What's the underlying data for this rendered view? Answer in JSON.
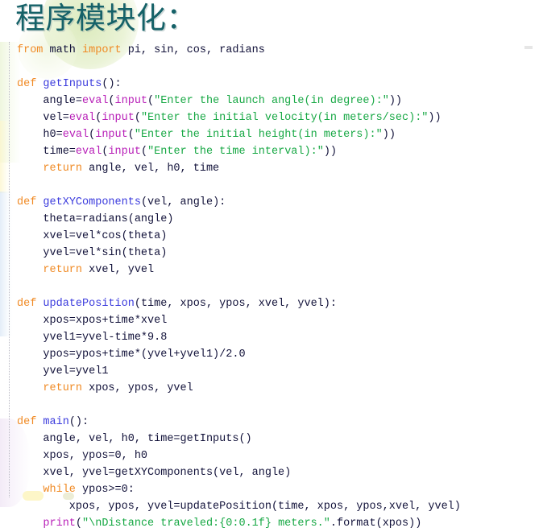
{
  "slide": {
    "title": "程序模块化：",
    "title_color": "#156168"
  },
  "theme": {
    "background": "#ffffff",
    "keyword_color": "#f08a24",
    "function_def_color": "#3b3bdd",
    "builtin_color": "#b820b8",
    "string_color": "#17a844",
    "plain_color": "#12123a",
    "gutter_border_color": "#b9b9c4"
  },
  "code": {
    "language": "python",
    "lines": [
      {
        "n": 1,
        "text": "from math import pi, sin, cos, radians"
      },
      {
        "n": 2,
        "text": ""
      },
      {
        "n": 3,
        "text": "def getInputs():"
      },
      {
        "n": 4,
        "text": "    angle=eval(input(\"Enter the launch angle(in degree):\"))"
      },
      {
        "n": 5,
        "text": "    vel=eval(input(\"Enter the initial velocity(in meters/sec):\"))"
      },
      {
        "n": 6,
        "text": "    h0=eval(input(\"Enter the initial height(in meters):\"))"
      },
      {
        "n": 7,
        "text": "    time=eval(input(\"Enter the time interval):\"))"
      },
      {
        "n": 8,
        "text": "    return angle, vel, h0, time"
      },
      {
        "n": 9,
        "text": ""
      },
      {
        "n": 10,
        "text": "def getXYComponents(vel, angle):"
      },
      {
        "n": 11,
        "text": "    theta=radians(angle)"
      },
      {
        "n": 12,
        "text": "    xvel=vel*cos(theta)"
      },
      {
        "n": 13,
        "text": "    yvel=vel*sin(theta)"
      },
      {
        "n": 14,
        "text": "    return xvel, yvel"
      },
      {
        "n": 15,
        "text": ""
      },
      {
        "n": 16,
        "text": "def updatePosition(time, xpos, ypos, xvel, yvel):"
      },
      {
        "n": 17,
        "text": "    xpos=xpos+time*xvel"
      },
      {
        "n": 18,
        "text": "    yvel1=yvel-time*9.8"
      },
      {
        "n": 19,
        "text": "    ypos=ypos+time*(yvel+yvel1)/2.0"
      },
      {
        "n": 20,
        "text": "    yvel=yvel1"
      },
      {
        "n": 21,
        "text": "    return xpos, ypos, yvel"
      },
      {
        "n": 22,
        "text": ""
      },
      {
        "n": 23,
        "text": "def main():"
      },
      {
        "n": 24,
        "text": "    angle, vel, h0, time=getInputs()"
      },
      {
        "n": 25,
        "text": "    xpos, ypos=0, h0"
      },
      {
        "n": 26,
        "text": "    xvel, yvel=getXYComponents(vel, angle)"
      },
      {
        "n": 27,
        "text": "    while ypos>=0:"
      },
      {
        "n": 28,
        "text": "        xpos, ypos, yvel=updatePosition(time, xpos, ypos,xvel, yvel)"
      },
      {
        "n": 29,
        "text": "    print(\"\\nDistance traveled:{0:0.1f} meters.\".format(xpos))"
      }
    ],
    "tokens": [
      [
        {
          "t": "from",
          "c": "kw"
        },
        {
          "t": " math ",
          "c": "pl"
        },
        {
          "t": "import",
          "c": "kw"
        },
        {
          "t": " pi, sin, cos, radians",
          "c": "pl"
        }
      ],
      [
        {
          "t": "",
          "c": "pl"
        }
      ],
      [
        {
          "t": "def",
          "c": "kw"
        },
        {
          "t": " ",
          "c": "pl"
        },
        {
          "t": "getInputs",
          "c": "def"
        },
        {
          "t": "():",
          "c": "pl"
        }
      ],
      [
        {
          "t": "    angle=",
          "c": "pl"
        },
        {
          "t": "eval",
          "c": "fn"
        },
        {
          "t": "(",
          "c": "pl"
        },
        {
          "t": "input",
          "c": "fn"
        },
        {
          "t": "(",
          "c": "pl"
        },
        {
          "t": "\"Enter the launch angle(in degree):\"",
          "c": "str"
        },
        {
          "t": "))",
          "c": "pl"
        }
      ],
      [
        {
          "t": "    vel=",
          "c": "pl"
        },
        {
          "t": "eval",
          "c": "fn"
        },
        {
          "t": "(",
          "c": "pl"
        },
        {
          "t": "input",
          "c": "fn"
        },
        {
          "t": "(",
          "c": "pl"
        },
        {
          "t": "\"Enter the initial velocity(in meters/sec):\"",
          "c": "str"
        },
        {
          "t": "))",
          "c": "pl"
        }
      ],
      [
        {
          "t": "    h0=",
          "c": "pl"
        },
        {
          "t": "eval",
          "c": "fn"
        },
        {
          "t": "(",
          "c": "pl"
        },
        {
          "t": "input",
          "c": "fn"
        },
        {
          "t": "(",
          "c": "pl"
        },
        {
          "t": "\"Enter the initial height(in meters):\"",
          "c": "str"
        },
        {
          "t": "))",
          "c": "pl"
        }
      ],
      [
        {
          "t": "    time=",
          "c": "pl"
        },
        {
          "t": "eval",
          "c": "fn"
        },
        {
          "t": "(",
          "c": "pl"
        },
        {
          "t": "input",
          "c": "fn"
        },
        {
          "t": "(",
          "c": "pl"
        },
        {
          "t": "\"Enter the time interval):\"",
          "c": "str"
        },
        {
          "t": "))",
          "c": "pl"
        }
      ],
      [
        {
          "t": "    ",
          "c": "pl"
        },
        {
          "t": "return",
          "c": "kw"
        },
        {
          "t": " angle, vel, h0, time",
          "c": "pl"
        }
      ],
      [
        {
          "t": "",
          "c": "pl"
        }
      ],
      [
        {
          "t": "def",
          "c": "kw"
        },
        {
          "t": " ",
          "c": "pl"
        },
        {
          "t": "getXYComponents",
          "c": "def"
        },
        {
          "t": "(vel, angle):",
          "c": "pl"
        }
      ],
      [
        {
          "t": "    theta=radians(angle)",
          "c": "pl"
        }
      ],
      [
        {
          "t": "    xvel=vel*cos(theta)",
          "c": "pl"
        }
      ],
      [
        {
          "t": "    yvel=vel*sin(theta)",
          "c": "pl"
        }
      ],
      [
        {
          "t": "    ",
          "c": "pl"
        },
        {
          "t": "return",
          "c": "kw"
        },
        {
          "t": " xvel, yvel",
          "c": "pl"
        }
      ],
      [
        {
          "t": "",
          "c": "pl"
        }
      ],
      [
        {
          "t": "def",
          "c": "kw"
        },
        {
          "t": " ",
          "c": "pl"
        },
        {
          "t": "updatePosition",
          "c": "def"
        },
        {
          "t": "(time, xpos, ypos, xvel, yvel):",
          "c": "pl"
        }
      ],
      [
        {
          "t": "    xpos=xpos+time*xvel",
          "c": "pl"
        }
      ],
      [
        {
          "t": "    yvel1=yvel-time*9.8",
          "c": "pl"
        }
      ],
      [
        {
          "t": "    ypos=ypos+time*(yvel+yvel1)/2.0",
          "c": "pl"
        }
      ],
      [
        {
          "t": "    yvel=yvel1",
          "c": "pl"
        }
      ],
      [
        {
          "t": "    ",
          "c": "pl"
        },
        {
          "t": "return",
          "c": "kw"
        },
        {
          "t": " xpos, ypos, yvel",
          "c": "pl"
        }
      ],
      [
        {
          "t": "",
          "c": "pl"
        }
      ],
      [
        {
          "t": "def",
          "c": "kw"
        },
        {
          "t": " ",
          "c": "pl"
        },
        {
          "t": "main",
          "c": "def"
        },
        {
          "t": "():",
          "c": "pl"
        }
      ],
      [
        {
          "t": "    angle, vel, h0, time=getInputs()",
          "c": "pl"
        }
      ],
      [
        {
          "t": "    xpos, ypos=0, h0",
          "c": "pl"
        }
      ],
      [
        {
          "t": "    xvel, yvel=getXYComponents(vel, angle)",
          "c": "pl"
        }
      ],
      [
        {
          "t": "    ",
          "c": "pl"
        },
        {
          "t": "while",
          "c": "kw"
        },
        {
          "t": " ypos>=0:",
          "c": "pl"
        }
      ],
      [
        {
          "t": "        xpos, ypos, yvel=updatePosition(time, xpos, ypos,xvel, yvel)",
          "c": "pl"
        }
      ],
      [
        {
          "t": "    ",
          "c": "pl"
        },
        {
          "t": "print",
          "c": "fn"
        },
        {
          "t": "(",
          "c": "pl"
        },
        {
          "t": "\"\\nDistance traveled:{0:0.1f} meters.\"",
          "c": "str"
        },
        {
          "t": ".format(xpos))",
          "c": "pl"
        }
      ]
    ]
  }
}
